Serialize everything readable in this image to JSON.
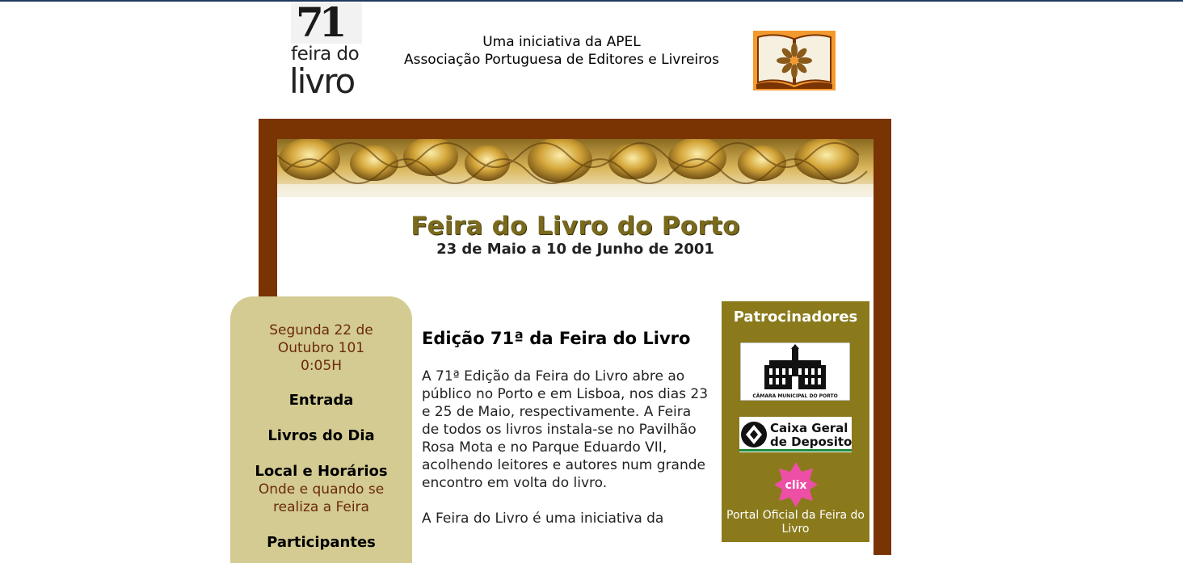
{
  "header": {
    "logo": {
      "number": "71",
      "line1": "feira do",
      "line2": "livro"
    },
    "initiative_line1": "Uma iniciativa da APEL",
    "initiative_line2": "Associação Portuguesa de Editores e Livreiros",
    "apel_logo_icon": "open-book-flower-icon"
  },
  "main": {
    "title": "Feira do Livro do Porto",
    "dates": "23 de Maio a 10 de Junho de 2001"
  },
  "nav": {
    "datetime_line1": "Segunda 22 de",
    "datetime_line2": "Outubro 101",
    "datetime_line3": "0:05H",
    "items": [
      {
        "label": "Entrada",
        "desc": ""
      },
      {
        "label": "Livros do Dia",
        "desc": ""
      },
      {
        "label": "Local e Horários",
        "desc1": "Onde e quando se",
        "desc2": "realiza a Feira"
      },
      {
        "label": "Participantes",
        "desc": ""
      }
    ]
  },
  "content": {
    "heading": "Edição 71ª da Feira do Livro",
    "paragraph1": "A 71ª Edição da Feira do Livro abre ao público no Porto e em Lisboa, nos dias 23 e 25 de Maio, respectivamente. A Feira de todos os livros instala-se no Pavilhão Rosa Mota e no Parque Eduardo VII, acolhendo leitores e autores num grande encontro em volta do livro.",
    "paragraph2": "A Feira do Livro é uma iniciativa da"
  },
  "sponsors": {
    "heading": "Patrocinadores",
    "cmp_text": "CÂMARA MUNICIPAL DO PORTO",
    "cgd_line1": "Caixa Geral",
    "cgd_line2": "de Depositos",
    "clix_text": "clix",
    "clix_caption": "Portal Oficial da Feira do Livro"
  },
  "colors": {
    "frame": "#7a3303",
    "nav_bg": "#d3cb91",
    "sponsor_bg": "#8a7a1c",
    "title_gold": "#7a6a1e",
    "apel_orange": "#f39a2e",
    "clix_pink": "#ee4fa6"
  }
}
